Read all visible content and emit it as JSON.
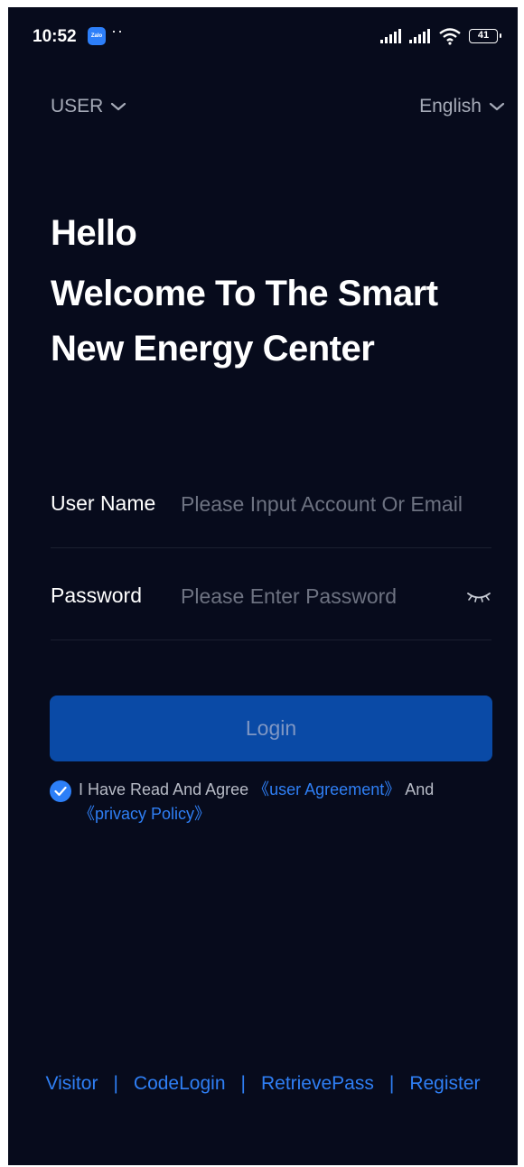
{
  "status_bar": {
    "time": "10:52",
    "app_badge": "Zalo",
    "notification_dots": "··",
    "battery": "41"
  },
  "header": {
    "role_selector": "USER",
    "language_selector": "English"
  },
  "headline": {
    "line1": "Hello",
    "line2": "Welcome To The Smart",
    "line3": "New Energy Center"
  },
  "form": {
    "username_label": "User Name",
    "username_placeholder": "Please Input Account Or Email",
    "username_value": "",
    "password_label": "Password",
    "password_placeholder": "Please Enter Password",
    "password_value": ""
  },
  "login_button": "Login",
  "agreement": {
    "checked": true,
    "prefix": "I Have Read And Agree ",
    "user_agreement": "《user Agreement》",
    "middle": " And ",
    "privacy_policy": "《privacy Policy》"
  },
  "footer": {
    "links": [
      "Visitor",
      "CodeLogin",
      "RetrievePass",
      "Register"
    ],
    "separator": "|"
  },
  "colors": {
    "background": "#070b1c",
    "primary_button": "#0a4aa6",
    "link": "#2f7ff5",
    "checkbox": "#2c7ff8"
  },
  "icons": {
    "dropdown": "chevron-down-icon",
    "password_toggle": "eye-closed-icon",
    "checkbox": "check-icon"
  }
}
